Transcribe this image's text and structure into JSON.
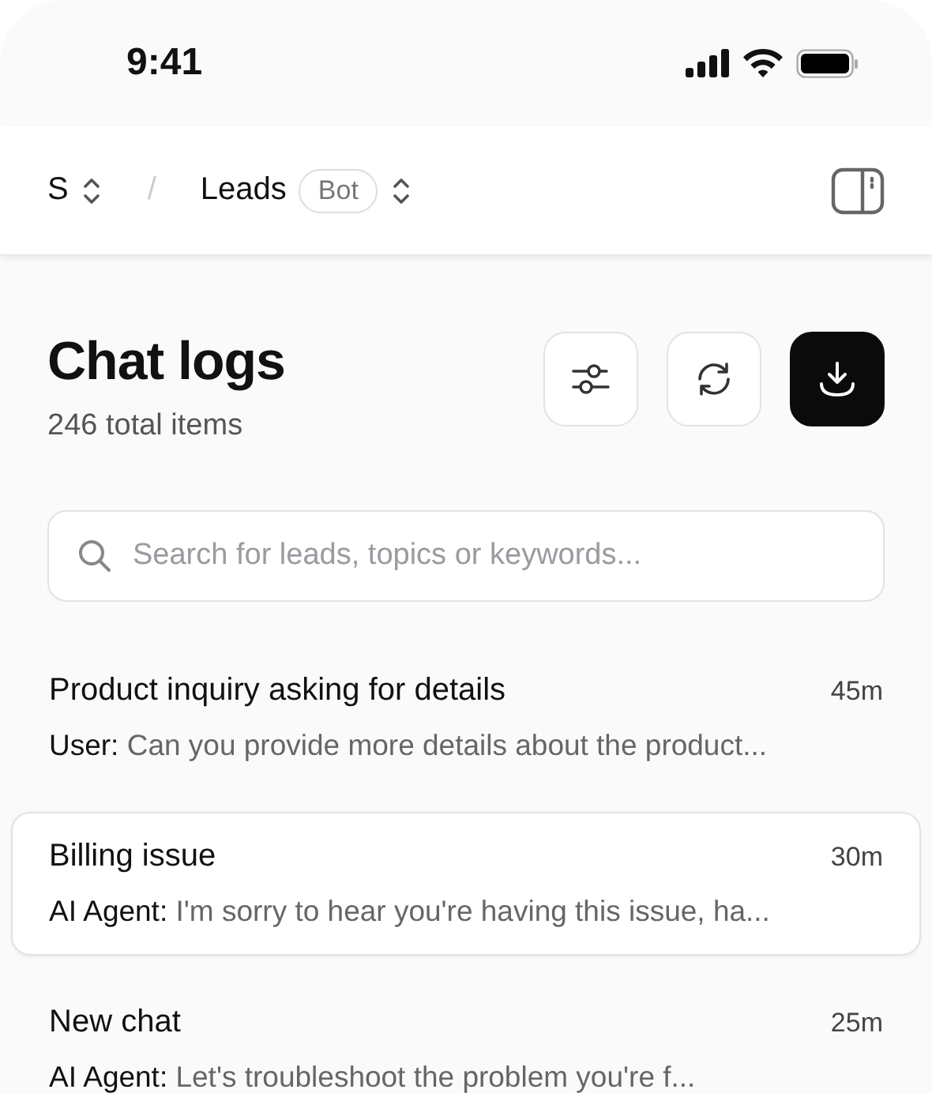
{
  "status_bar": {
    "time": "9:41"
  },
  "breadcrumb": {
    "workspace": "S",
    "separator": "/",
    "project": "Leads",
    "tag": "Bot"
  },
  "page": {
    "title": "Chat logs",
    "subtitle": "246 total items"
  },
  "search": {
    "placeholder": "Search for leads, topics or keywords..."
  },
  "chats": [
    {
      "title": "Product inquiry asking for details",
      "time": "45m",
      "sender": "User:",
      "preview": "Can you provide more details about the product...",
      "selected": false
    },
    {
      "title": "Billing issue",
      "time": "30m",
      "sender": "AI Agent:",
      "preview": "I'm sorry to hear you're having this issue, ha...",
      "selected": true
    },
    {
      "title": "New chat",
      "time": "25m",
      "sender": "AI Agent:",
      "preview": "Let's troubleshoot the problem you're f...",
      "selected": false
    }
  ]
}
